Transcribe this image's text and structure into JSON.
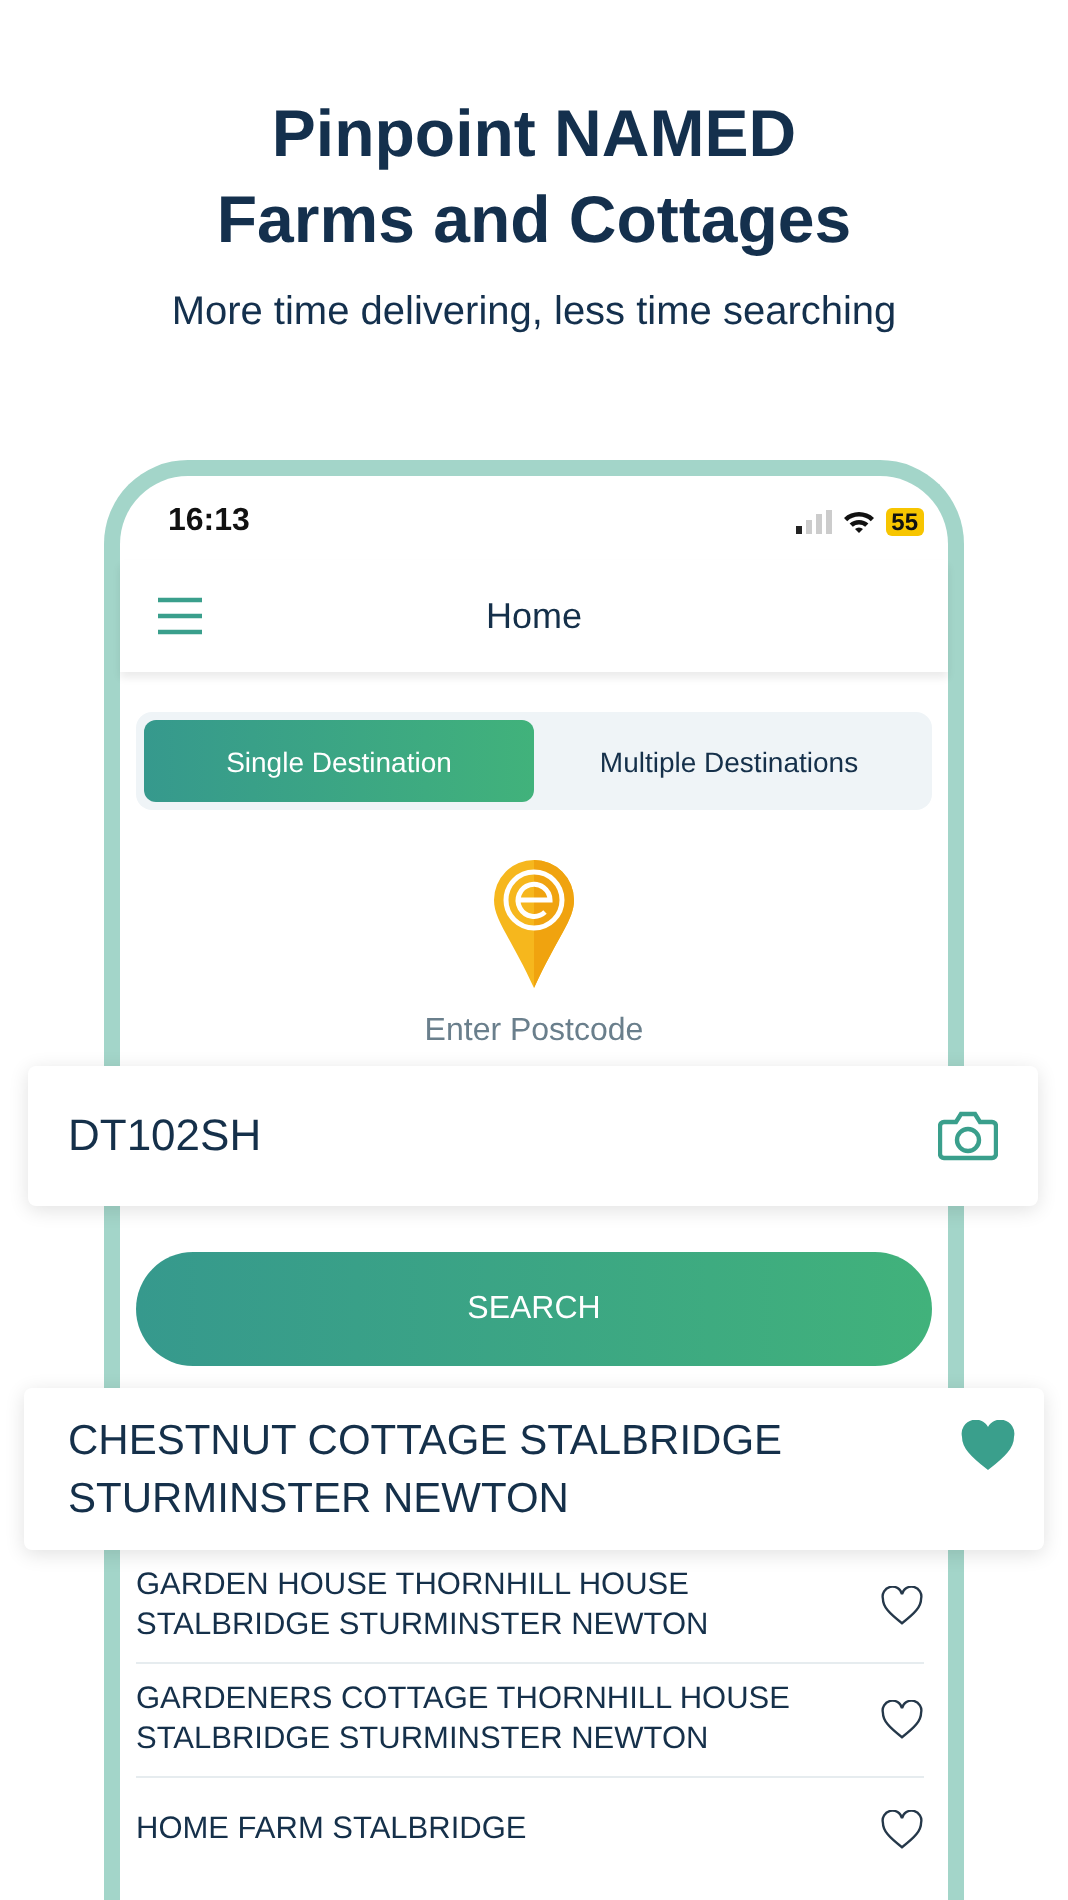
{
  "headline": {
    "title_lines": [
      "Pinpoint NAMED",
      "Farms and Cottages"
    ],
    "subtitle": "More time delivering, less time searching"
  },
  "status_bar": {
    "time": "16:13",
    "battery": "55"
  },
  "app_bar": {
    "title": "Home"
  },
  "tabs": [
    {
      "label": "Single Destination",
      "selected": true
    },
    {
      "label": "Multiple Destinations",
      "selected": false
    }
  ],
  "postcode": {
    "prompt": "Enter Postcode",
    "value": "DT102SH"
  },
  "search_button": "SEARCH",
  "results": [
    {
      "name": "CHESTNUT COTTAGE STALBRIDGE STURMINSTER NEWTON",
      "selected": true,
      "favorite": true
    },
    {
      "name": "GARDEN HOUSE THORNHILL HOUSE STALBRIDGE STURMINSTER NEWTON",
      "selected": false,
      "favorite": false
    },
    {
      "name": "GARDENERS COTTAGE THORNHILL HOUSE STALBRIDGE STURMINSTER NEWTON",
      "selected": false,
      "favorite": false
    },
    {
      "name": "HOME FARM STALBRIDGE",
      "selected": false,
      "favorite": false
    }
  ]
}
